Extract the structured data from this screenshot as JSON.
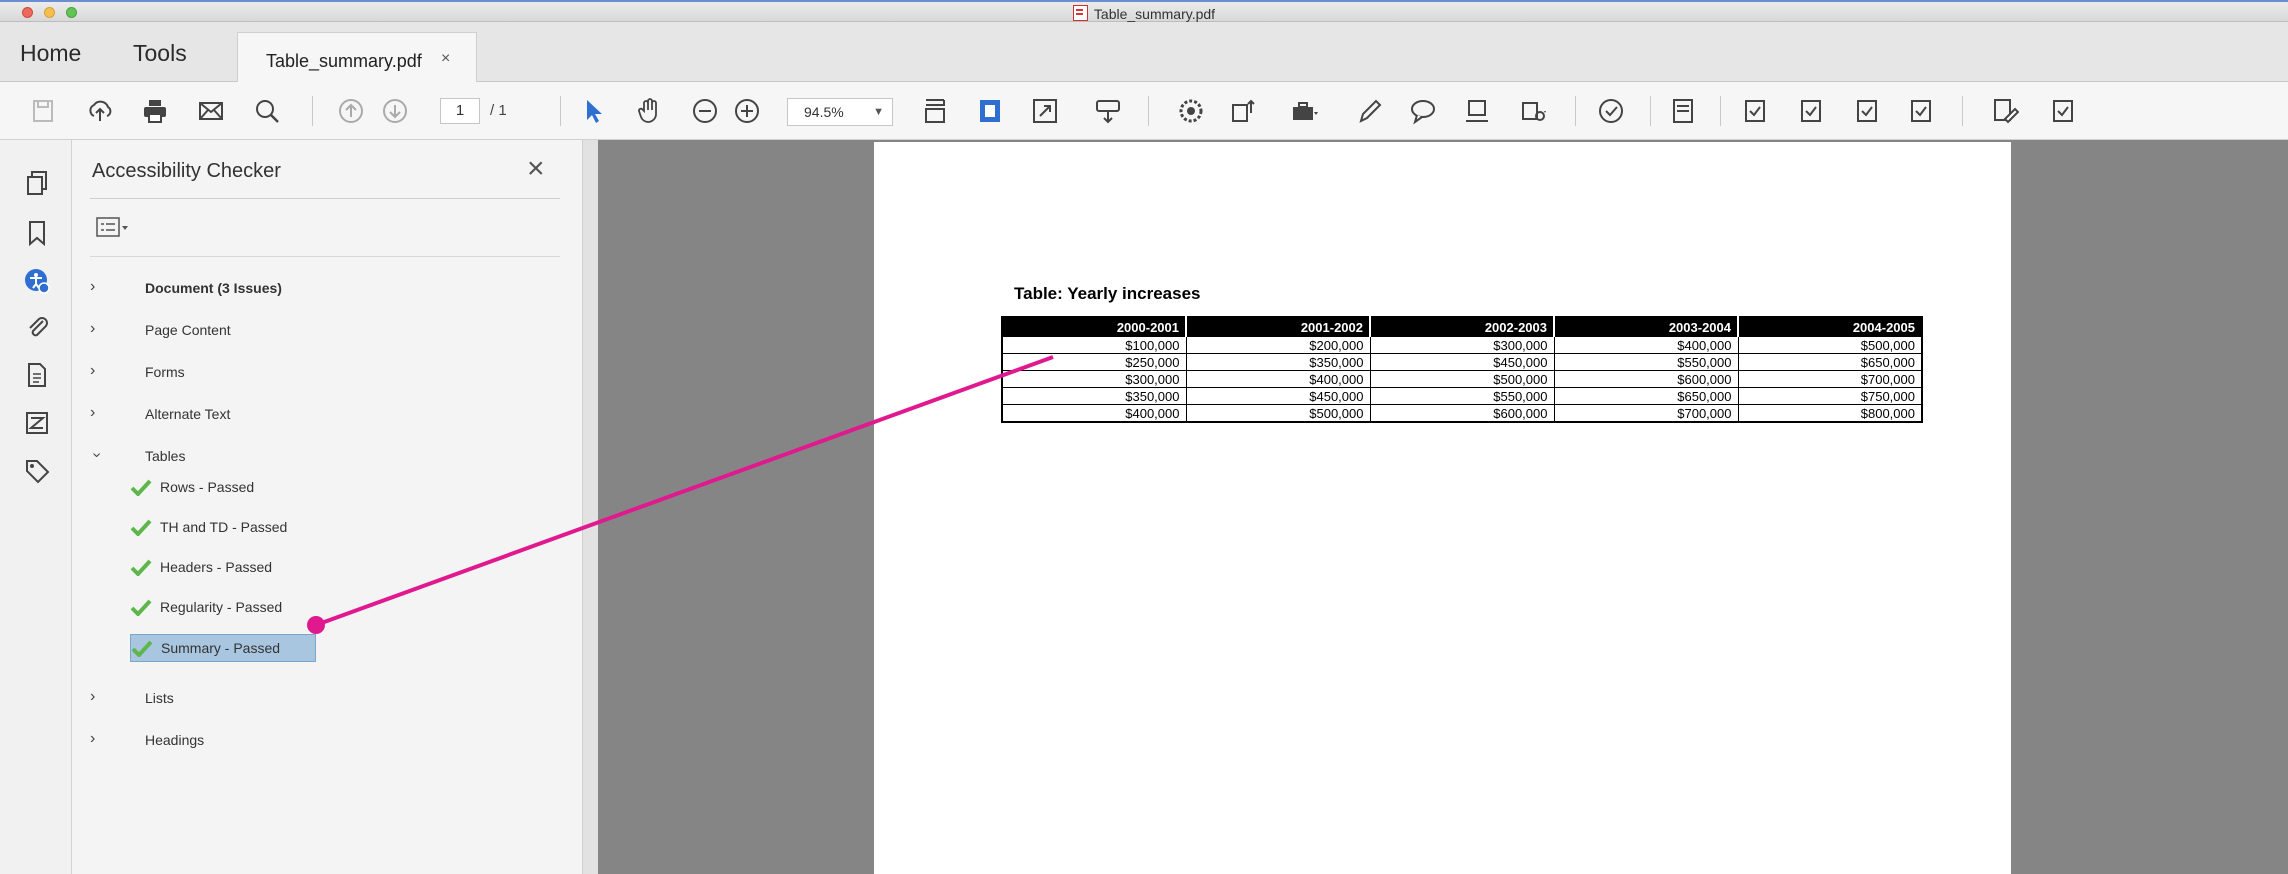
{
  "window": {
    "title": "Table_summary.pdf"
  },
  "tabs": {
    "home": "Home",
    "tools": "Tools",
    "document": "Table_summary.pdf",
    "document_close": "×"
  },
  "toolbar": {
    "page_current": "1",
    "page_total": "/ 1",
    "zoom": "94.5%",
    "icons": [
      "save-icon",
      "upload-icon",
      "print-icon",
      "email-icon",
      "search-icon",
      "prev-page-icon",
      "next-page-icon",
      "select-arrow-icon",
      "hand-icon",
      "zoom-out-icon",
      "zoom-in-icon",
      "scroll-mode-icon",
      "fit-page-icon",
      "fullscreen-icon",
      "read-mode-icon",
      "settings-icon",
      "export-icon",
      "toolbox-icon",
      "pen-icon",
      "comment-icon",
      "stamp-icon",
      "protect-icon",
      "check-circle-icon",
      "organize-icon",
      "form-check-icon"
    ]
  },
  "rail": {
    "icons": [
      "pages-icon",
      "bookmark-icon",
      "accessibility-icon",
      "attachment-icon",
      "document-icon",
      "content-icon",
      "tag-icon"
    ]
  },
  "panel": {
    "title": "Accessibility Checker",
    "close": "×",
    "items": [
      {
        "label": "Document (3 Issues)",
        "expanded": false,
        "bold": true
      },
      {
        "label": "Page Content",
        "expanded": false
      },
      {
        "label": "Forms",
        "expanded": false
      },
      {
        "label": "Alternate Text",
        "expanded": false
      },
      {
        "label": "Tables",
        "expanded": true
      }
    ],
    "table_checks": [
      {
        "label": "Rows - Passed"
      },
      {
        "label": "TH and TD - Passed"
      },
      {
        "label": "Headers - Passed"
      },
      {
        "label": "Regularity - Passed"
      },
      {
        "label": "Summary - Passed",
        "selected": true
      }
    ],
    "more_items": [
      {
        "label": "Lists"
      },
      {
        "label": "Headings"
      }
    ]
  },
  "document": {
    "caption": "Table: Yearly increases",
    "table": {
      "headers": [
        "2000-2001",
        "2001-2002",
        "2002-2003",
        "2003-2004",
        "2004-2005"
      ],
      "rows": [
        [
          "$100,000",
          "$200,000",
          "$300,000",
          "$400,000",
          "$500,000"
        ],
        [
          "$250,000",
          "$350,000",
          "$450,000",
          "$550,000",
          "$650,000"
        ],
        [
          "$300,000",
          "$400,000",
          "$500,000",
          "$600,000",
          "$700,000"
        ],
        [
          "$350,000",
          "$450,000",
          "$550,000",
          "$650,000",
          "$750,000"
        ],
        [
          "$400,000",
          "$500,000",
          "$600,000",
          "$700,000",
          "$800,000"
        ]
      ]
    }
  },
  "colors": {
    "annotation": "#e0198f",
    "selection": "#a9c6e0",
    "check": "#5fb64a"
  }
}
